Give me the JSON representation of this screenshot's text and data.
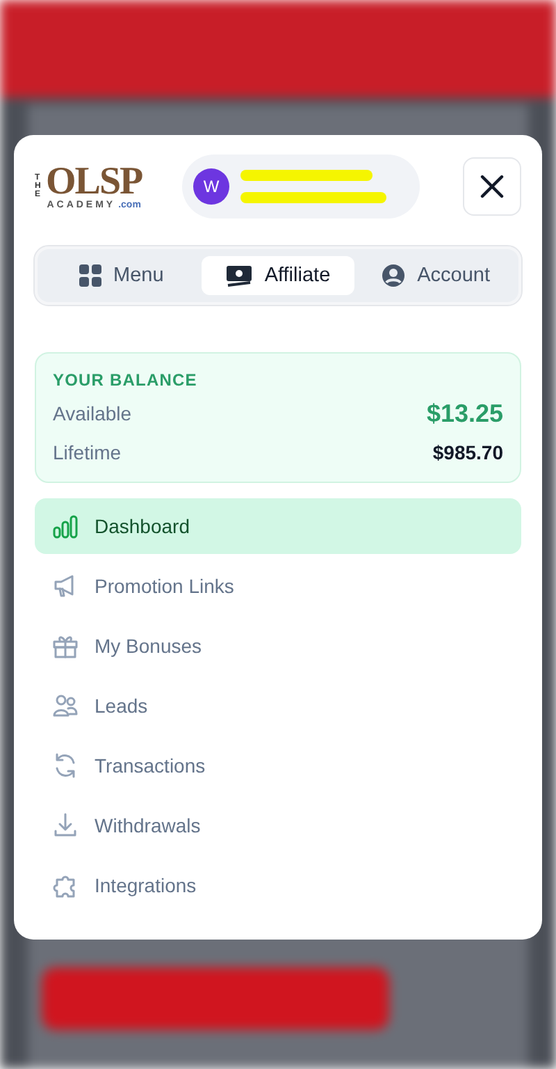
{
  "logo": {
    "top": "THE",
    "main": "OLSP",
    "sub": "ACADEMY",
    "suffix": ".com"
  },
  "user": {
    "initial": "W",
    "redacted": true
  },
  "tabs": [
    {
      "label": "Menu",
      "kind": "grid",
      "selected": false
    },
    {
      "label": "Affiliate",
      "kind": "money",
      "selected": true
    },
    {
      "label": "Account",
      "kind": "user",
      "selected": false
    }
  ],
  "balance": {
    "title": "YOUR BALANCE",
    "rows": [
      {
        "label": "Available",
        "value": "$13.25",
        "kind": "primary"
      },
      {
        "label": "Lifetime",
        "value": "$985.70",
        "kind": "secondary"
      }
    ]
  },
  "nav": [
    {
      "label": "Dashboard",
      "kind": "chart",
      "selected": true
    },
    {
      "label": "Promotion Links",
      "kind": "megaphone",
      "selected": false
    },
    {
      "label": "My Bonuses",
      "kind": "gift",
      "selected": false
    },
    {
      "label": "Leads",
      "kind": "users",
      "selected": false
    },
    {
      "label": "Transactions",
      "kind": "refresh",
      "selected": false
    },
    {
      "label": "Withdrawals",
      "kind": "download",
      "selected": false
    },
    {
      "label": "Integrations",
      "kind": "puzzle",
      "selected": false
    }
  ]
}
